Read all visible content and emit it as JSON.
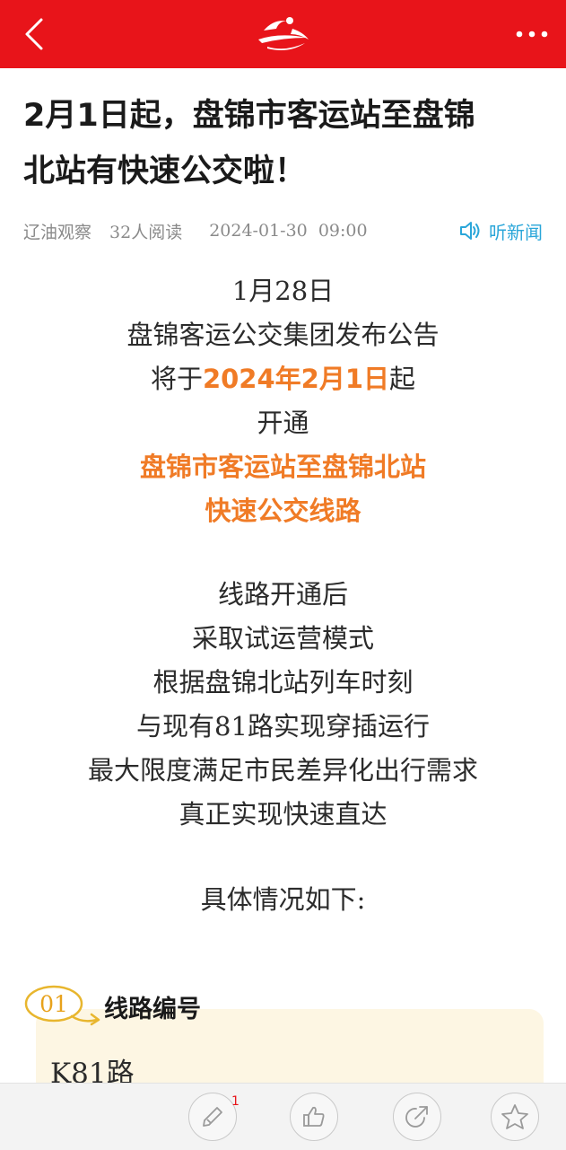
{
  "header": {
    "back_icon": "chevron-left-icon",
    "logo": "app-logo",
    "more_icon": "more-dots-icon",
    "bar_color": "#e8141a"
  },
  "article": {
    "title_line1": "2月1日起，盘锦市客运站至盘锦",
    "title_line2": "北站有快速公交啦！",
    "source": "辽油观察",
    "reads": "32人阅读",
    "date": "2024-01-30  09:00",
    "listen_label": "听新闻"
  },
  "content": {
    "l1": "1月28日",
    "l2": "盘锦客运公交集团发布公告",
    "l3_pre": "将于",
    "l3_hl": "2024年2月1日",
    "l3_post": "起",
    "l4": "开通",
    "l5": "盘锦市客运站至盘锦北站",
    "l6": "快速公交线路",
    "p2": [
      "线路开通后",
      "采取试运营模式",
      "根据盘锦北站列车时刻",
      "与现有81路实现穿插运行",
      "最大限度满足市民差异化出行需求",
      "真正实现快速直达"
    ],
    "detail_intro": "具体情况如下:",
    "highlight_color": "#f07b26"
  },
  "section": {
    "number": "01",
    "title": "线路编号",
    "value": "K81路",
    "box_color": "#fdf6e3"
  },
  "toolbar": {
    "comment_count": "1",
    "icons": [
      "pen-icon",
      "thumbs-up-icon",
      "share-icon",
      "star-icon"
    ]
  }
}
